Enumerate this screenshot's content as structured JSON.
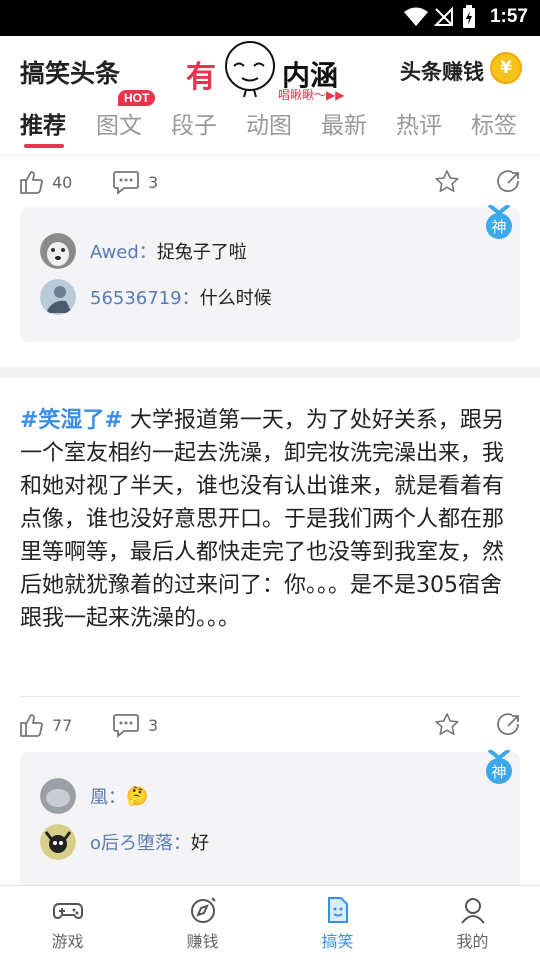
{
  "status": {
    "time": "1:57"
  },
  "header": {
    "brand": "搞笑头条",
    "logo_left": "有",
    "logo_right": "内涵",
    "logo_sub": "唱瞅瞅～▶▶",
    "earn_label": "头条赚钱",
    "coin_symbol": "¥"
  },
  "tabs": [
    {
      "label": "推荐",
      "active": true
    },
    {
      "label": "图文",
      "badge": "HOT"
    },
    {
      "label": "段子"
    },
    {
      "label": "动图"
    },
    {
      "label": "最新"
    },
    {
      "label": "热评"
    },
    {
      "label": "标签"
    }
  ],
  "posts": [
    {
      "likes": "40",
      "comments_count": "3",
      "god_badge": "神",
      "top_comments": [
        {
          "user": "Awed：",
          "text": "捉兔子了啦"
        },
        {
          "user": "56536719：",
          "text": "什么时候"
        }
      ]
    },
    {
      "tag": "#笑湿了#",
      "text": " 大学报道第一天，为了处好关系，跟另一个室友相约一起去洗澡，卸完妆洗完澡出来，我和她对视了半天，谁也没有认出谁来，就是看着有点像，谁也没好意思开口。于是我们两个人都在那里等啊等，最后人都快走完了也没等到我室友，然后她就犹豫着的过来问了：你。。。是不是305宿舍跟我一起来洗澡的。。。",
      "likes": "77",
      "comments_count": "3",
      "god_badge": "神",
      "top_comments": [
        {
          "user": "凰：",
          "text": "🤔"
        },
        {
          "user": "o后ろ堕落：",
          "text": "好"
        }
      ]
    }
  ],
  "bottom_nav": [
    {
      "label": "游戏",
      "icon": "gamepad-icon"
    },
    {
      "label": "赚钱",
      "icon": "compass-icon"
    },
    {
      "label": "搞笑",
      "icon": "smile-doc-icon",
      "active": true
    },
    {
      "label": "我的",
      "icon": "user-icon"
    }
  ]
}
